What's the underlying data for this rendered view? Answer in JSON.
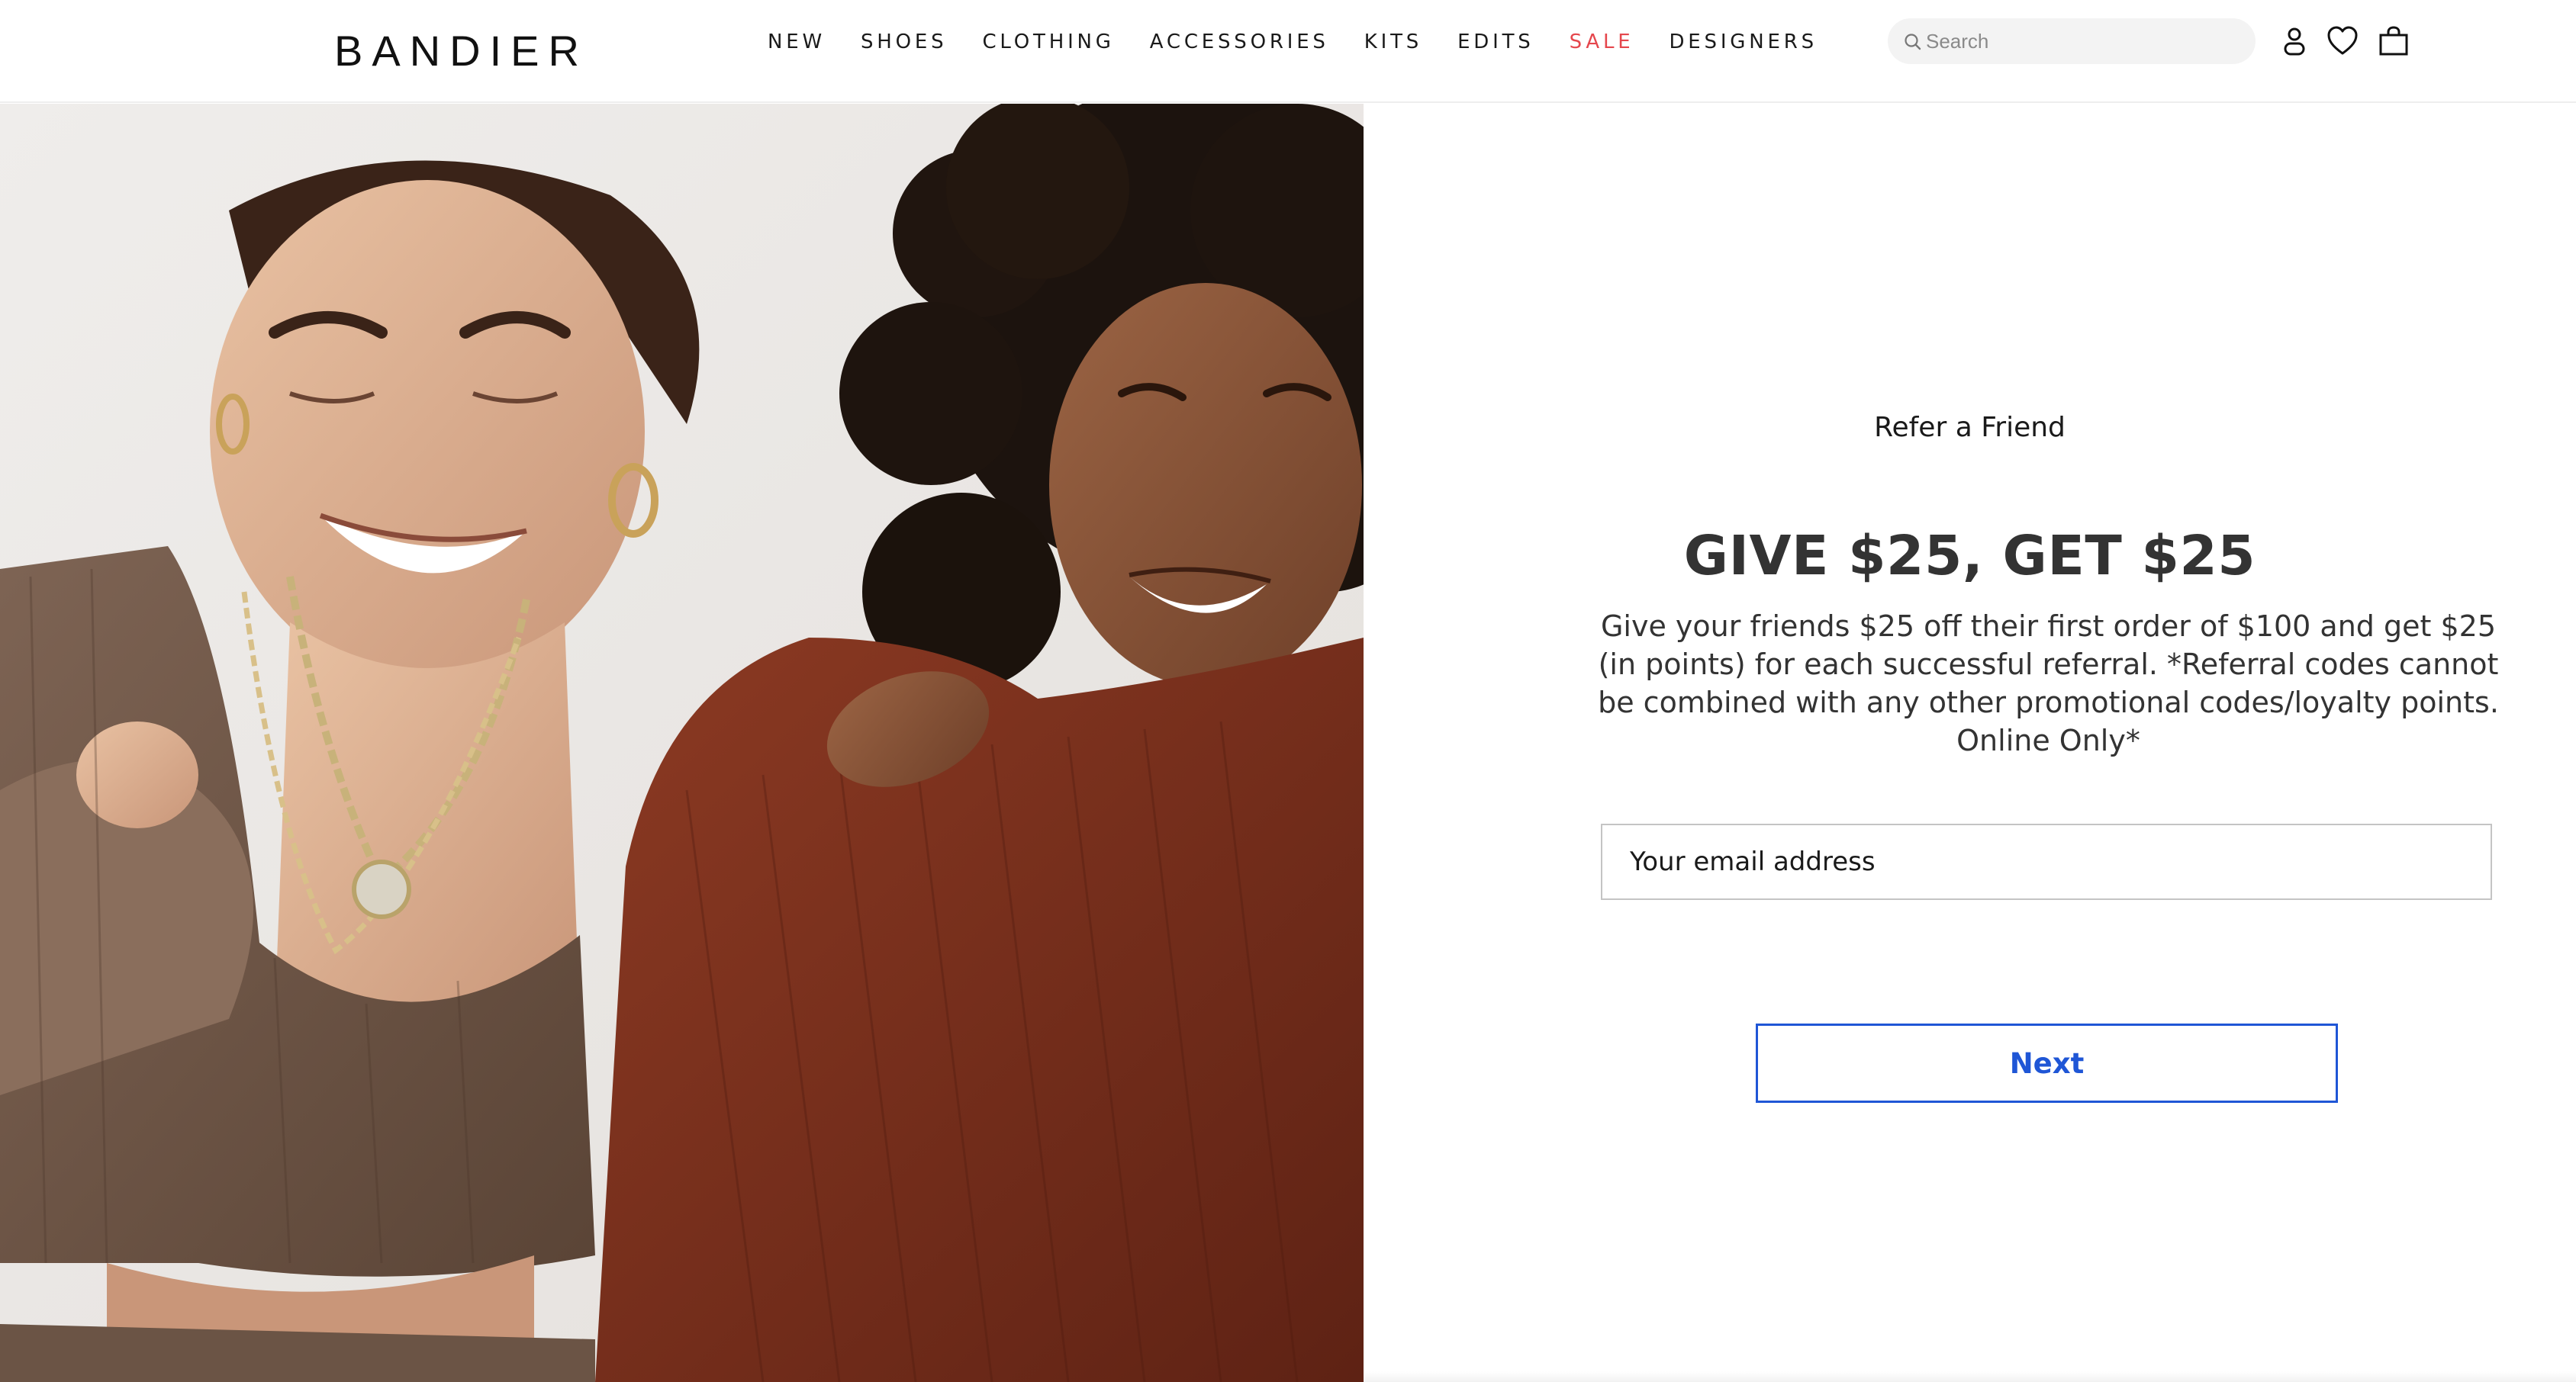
{
  "brand": {
    "logo_text": "BANDIER"
  },
  "colors": {
    "accent": "#1f56d6",
    "sale": "#e5474d"
  },
  "nav": {
    "items": [
      {
        "label": "NEW"
      },
      {
        "label": "SHOES"
      },
      {
        "label": "CLOTHING"
      },
      {
        "label": "ACCESSORIES"
      },
      {
        "label": "KITS"
      },
      {
        "label": "EDITS"
      },
      {
        "label": "SALE"
      },
      {
        "label": "DESIGNERS"
      }
    ]
  },
  "search": {
    "placeholder": "Search",
    "icon": "search-icon"
  },
  "header_icons": [
    "account-icon",
    "heart-icon",
    "shopping-bag-icon"
  ],
  "referral": {
    "eyebrow": "Refer a Friend",
    "headline": "GIVE $25, GET $25",
    "description": "Give your friends $25 off their first order of $100 and get $25 (in points) for each successful referral. *Referral codes cannot be combined with any other promotional codes/loyalty points. Online Only*",
    "email_placeholder": "Your email address",
    "next_label": "Next"
  }
}
